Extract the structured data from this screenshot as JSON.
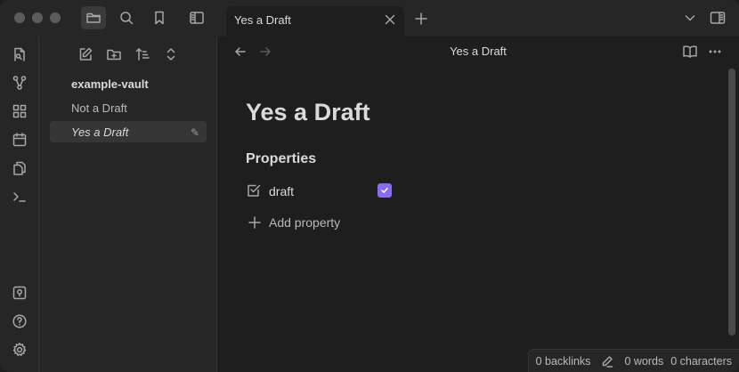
{
  "tab": {
    "title": "Yes a Draft"
  },
  "sidebar": {
    "vault_name": "example-vault",
    "files": [
      {
        "label": "Not a Draft",
        "active": false
      },
      {
        "label": "Yes a Draft",
        "active": true
      }
    ]
  },
  "main": {
    "header_title": "Yes a Draft",
    "heading": "Yes a Draft",
    "properties_heading": "Properties",
    "properties": [
      {
        "key": "draft",
        "type": "checkbox",
        "value": true
      }
    ],
    "add_property_label": "Add property"
  },
  "status_bar": {
    "backlinks": "0 backlinks",
    "words": "0 words",
    "characters": "0 characters"
  },
  "colors": {
    "accent": "#8b6cef"
  }
}
